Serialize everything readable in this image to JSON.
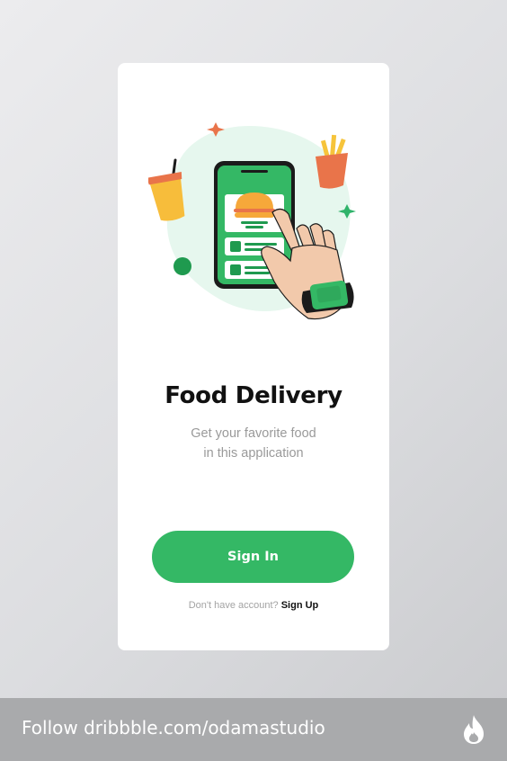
{
  "onboarding": {
    "title": "Food Delivery",
    "subtitle_line1": "Get your favorite food",
    "subtitle_line2": "in this application",
    "signin_label": "Sign In",
    "no_account_text": "Don't have account?",
    "signup_label": "Sign Up"
  },
  "footer": {
    "follow_text": "Follow dribbble.com/odamastudio",
    "logo_icon": "dribbble-flame-icon"
  },
  "colors": {
    "accent": "#34b865",
    "dark_green": "#1f9a4f",
    "burger_bun": "#f6a83a",
    "skin": "#f2c9ab"
  }
}
